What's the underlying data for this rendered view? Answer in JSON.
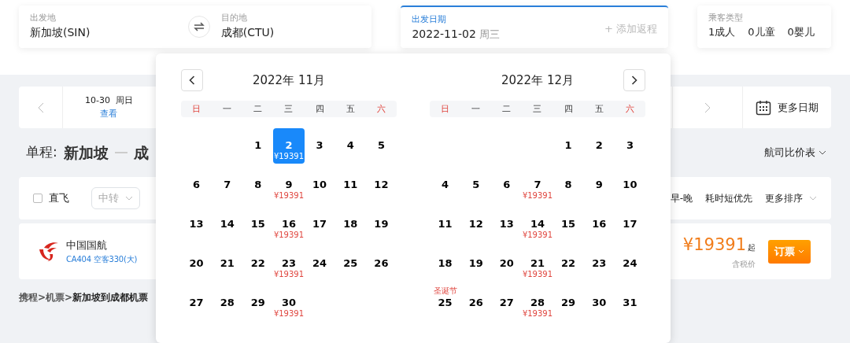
{
  "search": {
    "from": {
      "label": "出发地",
      "value": "新加坡(SIN)"
    },
    "to": {
      "label": "目的地",
      "value": "成都(CTU)"
    },
    "date": {
      "label": "出发日期",
      "value": "2022-11-02",
      "weekday": "周三",
      "return_hint": "+ 添加返程",
      "active": true
    },
    "passengers": {
      "label": "乘客类型",
      "values": [
        "1成人",
        "0儿童",
        "0婴儿"
      ]
    }
  },
  "date_strip": {
    "items": [
      {
        "date": "10-30  周日",
        "link": "查看"
      }
    ],
    "more": "更多日期"
  },
  "route": {
    "label": "单程:",
    "from": "新加坡",
    "to": "成",
    "compare": "航司比价表"
  },
  "filters": {
    "direct": {
      "label": "直飞",
      "checked": false
    },
    "transfer": "中转",
    "sorts": [
      "早-晚",
      "耗时短优先"
    ],
    "more": "更多排序"
  },
  "flight": {
    "airline": "中国国航",
    "flight_no": "CA404 空客330(大)",
    "price": "¥19391",
    "suffix": "起",
    "tax": "含税价",
    "book": "订票"
  },
  "breadcrumb": [
    {
      "text": "携程",
      "current": false
    },
    {
      "text": ">",
      "current": false
    },
    {
      "text": "机票",
      "current": false
    },
    {
      "text": ">",
      "current": false
    },
    {
      "text": "新加坡到成都机票",
      "current": true
    }
  ],
  "calendar": {
    "months": [
      {
        "title": "2022年 11月",
        "kind": "prev",
        "weekdays": [
          {
            "label": "日",
            "weekend": true
          },
          {
            "label": "一",
            "weekend": false
          },
          {
            "label": "二",
            "weekend": false
          },
          {
            "label": "三",
            "weekend": false
          },
          {
            "label": "四",
            "weekend": false
          },
          {
            "label": "五",
            "weekend": false
          },
          {
            "label": "六",
            "weekend": true
          }
        ],
        "days": [
          {
            "kind": "blank"
          },
          {
            "kind": "blank"
          },
          {
            "kind": "day",
            "day": "1",
            "selected": false
          },
          {
            "kind": "day",
            "day": "2",
            "price": "¥19391",
            "selected": true
          },
          {
            "kind": "day",
            "day": "3",
            "selected": false
          },
          {
            "kind": "day",
            "day": "4",
            "selected": false
          },
          {
            "kind": "day",
            "day": "5",
            "selected": false
          },
          {
            "kind": "day",
            "day": "6",
            "selected": false
          },
          {
            "kind": "day",
            "day": "7",
            "selected": false
          },
          {
            "kind": "day",
            "day": "8",
            "selected": false
          },
          {
            "kind": "day",
            "day": "9",
            "price": "¥19391",
            "selected": false
          },
          {
            "kind": "day",
            "day": "10",
            "selected": false
          },
          {
            "kind": "day",
            "day": "11",
            "selected": false
          },
          {
            "kind": "day",
            "day": "12",
            "selected": false
          },
          {
            "kind": "day",
            "day": "13",
            "selected": false
          },
          {
            "kind": "day",
            "day": "14",
            "selected": false
          },
          {
            "kind": "day",
            "day": "15",
            "selected": false
          },
          {
            "kind": "day",
            "day": "16",
            "price": "¥19391",
            "selected": false
          },
          {
            "kind": "day",
            "day": "17",
            "selected": false
          },
          {
            "kind": "day",
            "day": "18",
            "selected": false
          },
          {
            "kind": "day",
            "day": "19",
            "selected": false
          },
          {
            "kind": "day",
            "day": "20",
            "selected": false
          },
          {
            "kind": "day",
            "day": "21",
            "selected": false
          },
          {
            "kind": "day",
            "day": "22",
            "selected": false
          },
          {
            "kind": "day",
            "day": "23",
            "price": "¥19391",
            "selected": false
          },
          {
            "kind": "day",
            "day": "24",
            "selected": false
          },
          {
            "kind": "day",
            "day": "25",
            "selected": false
          },
          {
            "kind": "day",
            "day": "26",
            "selected": false
          },
          {
            "kind": "day",
            "day": "27",
            "selected": false
          },
          {
            "kind": "day",
            "day": "28",
            "selected": false
          },
          {
            "kind": "day",
            "day": "29",
            "selected": false
          },
          {
            "kind": "day",
            "day": "30",
            "price": "¥19391",
            "selected": false
          }
        ]
      },
      {
        "title": "2022年 12月",
        "kind": "next",
        "weekdays": [
          {
            "label": "日",
            "weekend": true
          },
          {
            "label": "一",
            "weekend": false
          },
          {
            "label": "二",
            "weekend": false
          },
          {
            "label": "三",
            "weekend": false
          },
          {
            "label": "四",
            "weekend": false
          },
          {
            "label": "五",
            "weekend": false
          },
          {
            "label": "六",
            "weekend": true
          }
        ],
        "days": [
          {
            "kind": "blank"
          },
          {
            "kind": "blank"
          },
          {
            "kind": "blank"
          },
          {
            "kind": "blank"
          },
          {
            "kind": "day",
            "day": "1",
            "selected": false
          },
          {
            "kind": "day",
            "day": "2",
            "selected": false
          },
          {
            "kind": "day",
            "day": "3",
            "selected": false
          },
          {
            "kind": "day",
            "day": "4",
            "selected": false
          },
          {
            "kind": "day",
            "day": "5",
            "selected": false
          },
          {
            "kind": "day",
            "day": "6",
            "selected": false
          },
          {
            "kind": "day",
            "day": "7",
            "price": "¥19391",
            "selected": false
          },
          {
            "kind": "day",
            "day": "8",
            "selected": false
          },
          {
            "kind": "day",
            "day": "9",
            "selected": false
          },
          {
            "kind": "day",
            "day": "10",
            "selected": false
          },
          {
            "kind": "day",
            "day": "11",
            "selected": false
          },
          {
            "kind": "day",
            "day": "12",
            "selected": false
          },
          {
            "kind": "day",
            "day": "13",
            "selected": false
          },
          {
            "kind": "day",
            "day": "14",
            "price": "¥19391",
            "selected": false
          },
          {
            "kind": "day",
            "day": "15",
            "selected": false
          },
          {
            "kind": "day",
            "day": "16",
            "selected": false
          },
          {
            "kind": "day",
            "day": "17",
            "selected": false
          },
          {
            "kind": "day",
            "day": "18",
            "selected": false
          },
          {
            "kind": "day",
            "day": "19",
            "selected": false
          },
          {
            "kind": "day",
            "day": "20",
            "selected": false
          },
          {
            "kind": "day",
            "day": "21",
            "price": "¥19391",
            "selected": false
          },
          {
            "kind": "day",
            "day": "22",
            "selected": false
          },
          {
            "kind": "day",
            "day": "23",
            "selected": false
          },
          {
            "kind": "day",
            "day": "24",
            "selected": false
          },
          {
            "kind": "day",
            "day": "25",
            "holiday": "圣诞节",
            "selected": false
          },
          {
            "kind": "day",
            "day": "26",
            "selected": false
          },
          {
            "kind": "day",
            "day": "27",
            "selected": false
          },
          {
            "kind": "day",
            "day": "28",
            "price": "¥19391",
            "selected": false
          },
          {
            "kind": "day",
            "day": "29",
            "selected": false
          },
          {
            "kind": "day",
            "day": "30",
            "selected": false
          },
          {
            "kind": "day",
            "day": "31",
            "selected": false
          }
        ]
      }
    ]
  }
}
